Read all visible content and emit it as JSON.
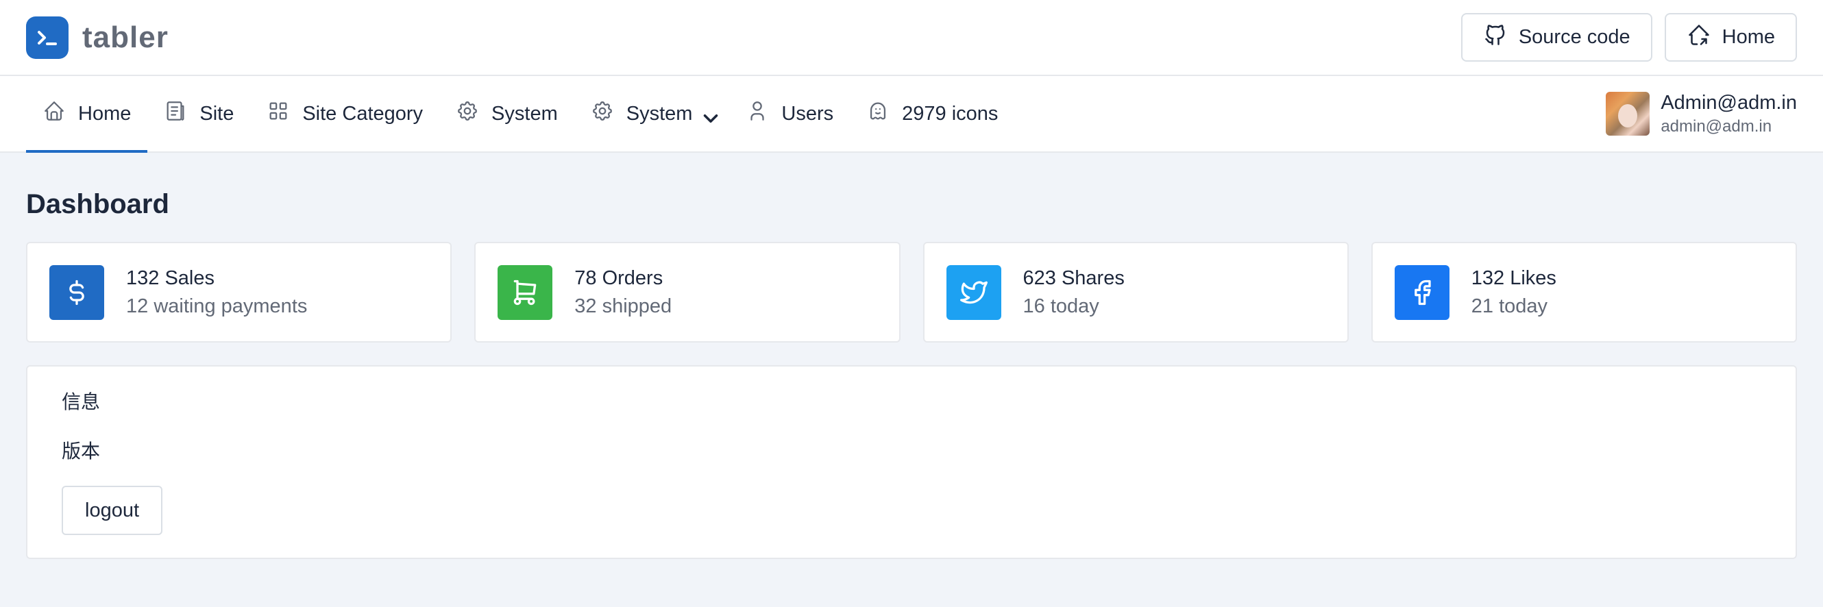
{
  "brand": {
    "name": "tabler",
    "color": "#206bc4"
  },
  "header_actions": [
    {
      "label": "Source code",
      "icon": "github-icon"
    },
    {
      "label": "Home",
      "icon": "home-icon"
    }
  ],
  "nav": {
    "items": [
      {
        "label": "Home",
        "icon": "home-icon",
        "active": true
      },
      {
        "label": "Site",
        "icon": "file-text-icon"
      },
      {
        "label": "Site Category",
        "icon": "grid-icon"
      },
      {
        "label": "System",
        "icon": "settings-icon"
      },
      {
        "label": "System",
        "icon": "settings-icon",
        "dropdown": true
      },
      {
        "label": "Users",
        "icon": "user-icon"
      },
      {
        "label": "2979 icons",
        "icon": "ghost-icon"
      }
    ]
  },
  "user": {
    "name": "Admin@adm.in",
    "email": "admin@adm.in"
  },
  "page": {
    "title": "Dashboard"
  },
  "cards": [
    {
      "title": "132 Sales",
      "subtitle": "12 waiting payments",
      "icon": "dollar-icon",
      "color": "#206bc4"
    },
    {
      "title": "78 Orders",
      "subtitle": "32 shipped",
      "icon": "shopping-cart-icon",
      "color": "#3ab54a"
    },
    {
      "title": "623 Shares",
      "subtitle": "16 today",
      "icon": "twitter-icon",
      "color": "#1da1f2"
    },
    {
      "title": "132 Likes",
      "subtitle": "21 today",
      "icon": "facebook-icon",
      "color": "#1877f2"
    }
  ],
  "info": {
    "line1": "信息",
    "line2": "版本",
    "logout_label": "logout"
  }
}
